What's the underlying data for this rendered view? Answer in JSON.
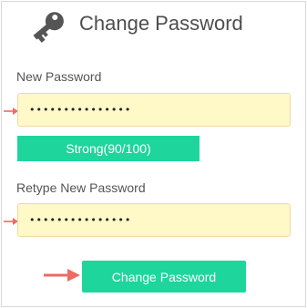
{
  "header": {
    "icon": "key-icon",
    "title": "Change Password"
  },
  "new_password": {
    "label": "New Password",
    "value": "•••••••••••••••",
    "pointer_icon": "arrow-right-icon"
  },
  "strength_meter": {
    "text": "Strong(90/100)",
    "score": 90,
    "max": 100,
    "color": "#1ed59c"
  },
  "retype_password": {
    "label": "Retype New Password",
    "value": "•••••••••••••••",
    "pointer_icon": "arrow-right-icon"
  },
  "submit": {
    "label": "Change Password",
    "pointer_icon": "arrow-right-icon"
  },
  "colors": {
    "accent": "#1ed59c",
    "input_background": "#fff8c7",
    "arrow": "#ef6a63"
  }
}
